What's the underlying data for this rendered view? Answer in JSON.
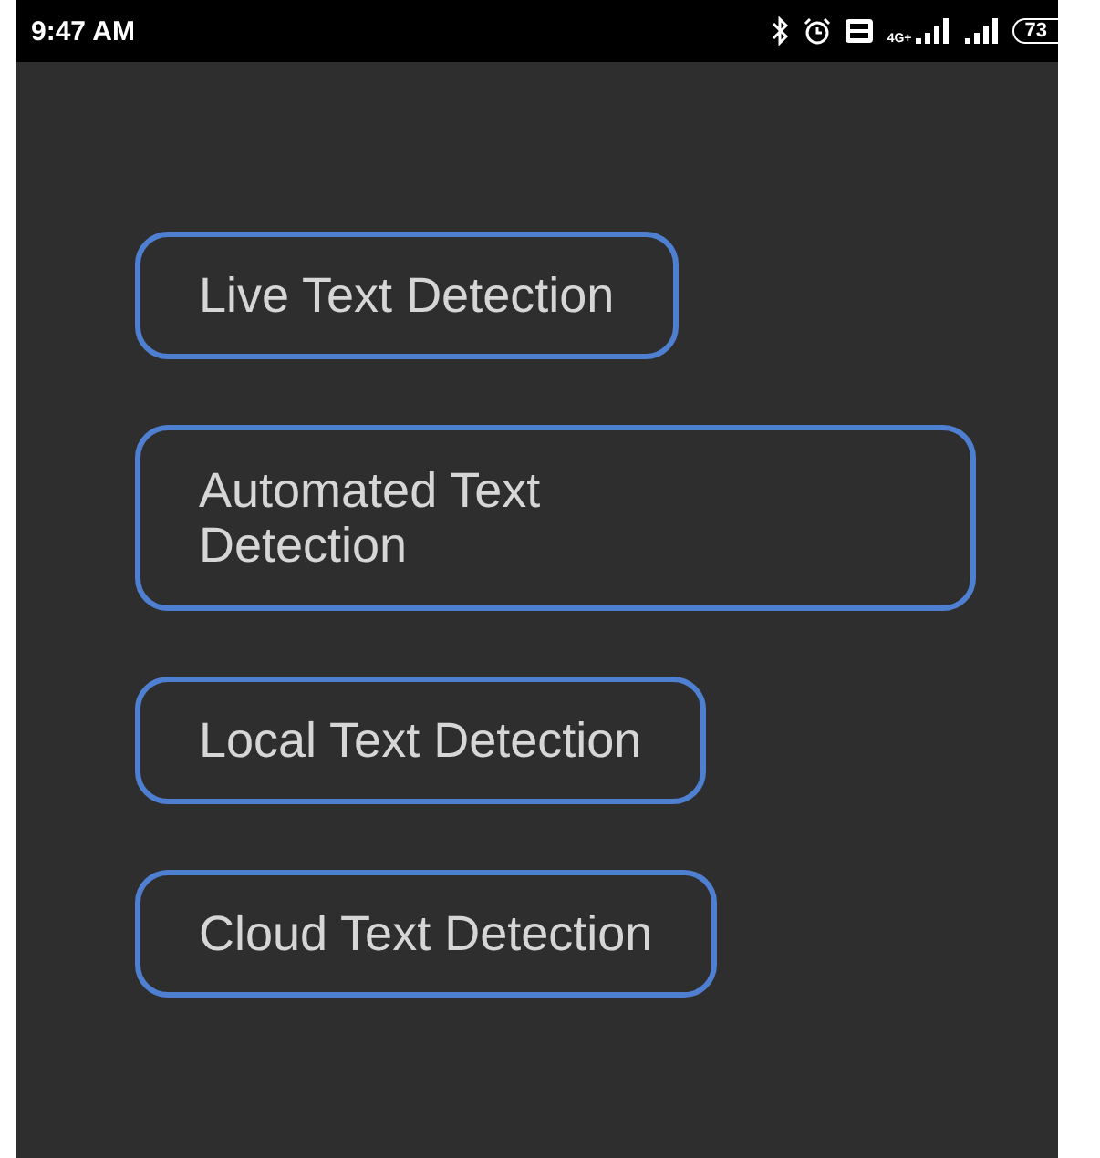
{
  "status_bar": {
    "time": "9:47 AM",
    "network": "4G+",
    "battery": "73"
  },
  "buttons": [
    {
      "label": "Live Text Detection"
    },
    {
      "label": "Automated Text\nDetection"
    },
    {
      "label": "Local Text Detection"
    },
    {
      "label": "Cloud Text Detection"
    }
  ]
}
